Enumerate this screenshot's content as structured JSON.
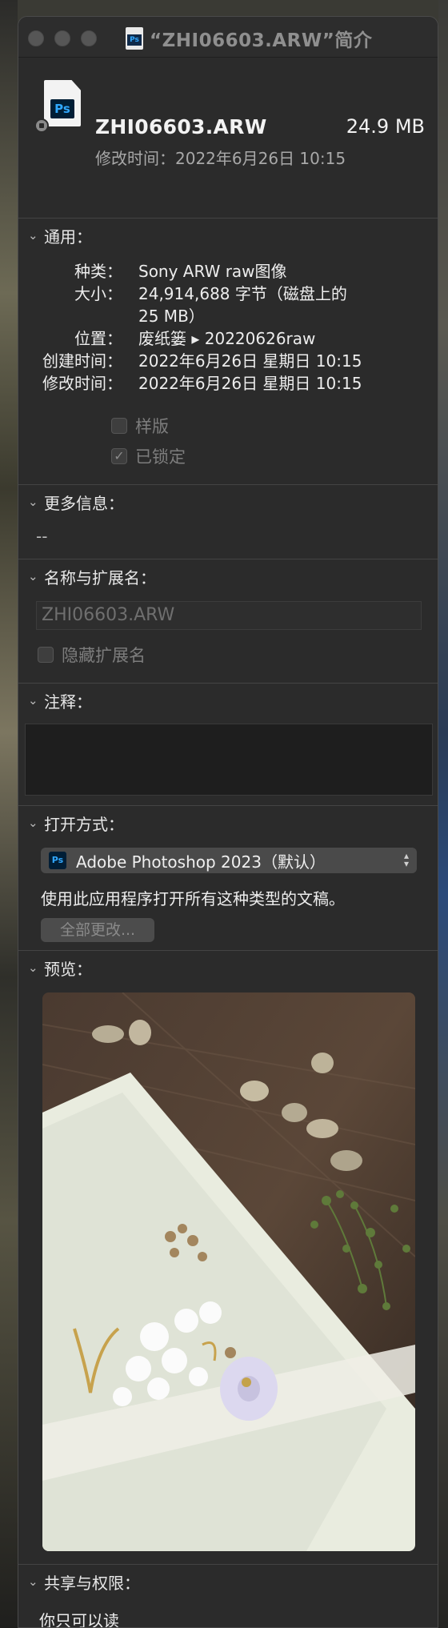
{
  "window": {
    "title": "“ZHI06603.ARW”简介"
  },
  "file": {
    "name": "ZHI06603.ARW",
    "size": "24.9 MB",
    "modified_line": "修改时间：2022年6月26日 10:15",
    "icon": "photoshop-document-icon"
  },
  "general": {
    "title": "通用：",
    "rows": [
      {
        "label": "种类：",
        "value": "Sony ARW raw图像"
      },
      {
        "label": "大小：",
        "value": "24,914,688 字节（磁盘上的"
      },
      {
        "label": "",
        "value": "25 MB）"
      },
      {
        "label": "位置：",
        "value": "废纸篓 ▸ 20220626raw"
      },
      {
        "label": "创建时间：",
        "value": "2022年6月26日 星期日 10:15"
      },
      {
        "label": "修改时间：",
        "value": "2022年6月26日 星期日 10:15"
      }
    ],
    "stationery_label": "样版",
    "locked_label": "已锁定",
    "stationery_checked": false,
    "locked_checked": true
  },
  "more_info": {
    "title": "更多信息：",
    "value": "--"
  },
  "name_ext": {
    "title": "名称与扩展名：",
    "field_value": "ZHI06603.ARW",
    "hide_ext_label": "隐藏扩展名"
  },
  "comments": {
    "title": "注释："
  },
  "open_with": {
    "title": "打开方式：",
    "app": "Adobe Photoshop 2023（默认）",
    "description": "使用此应用程序打开所有这种类型的文稿。",
    "change_all_label": "全部更改..."
  },
  "preview": {
    "title": "预览："
  },
  "sharing": {
    "title": "共享与权限：",
    "permission": "你只可以读"
  },
  "colors": {
    "window_bg": "#2b2b2b",
    "text": "#ededed",
    "dim_text": "#8a8a8a",
    "ps_blue": "#31a8ff",
    "ps_dark": "#001e36"
  }
}
